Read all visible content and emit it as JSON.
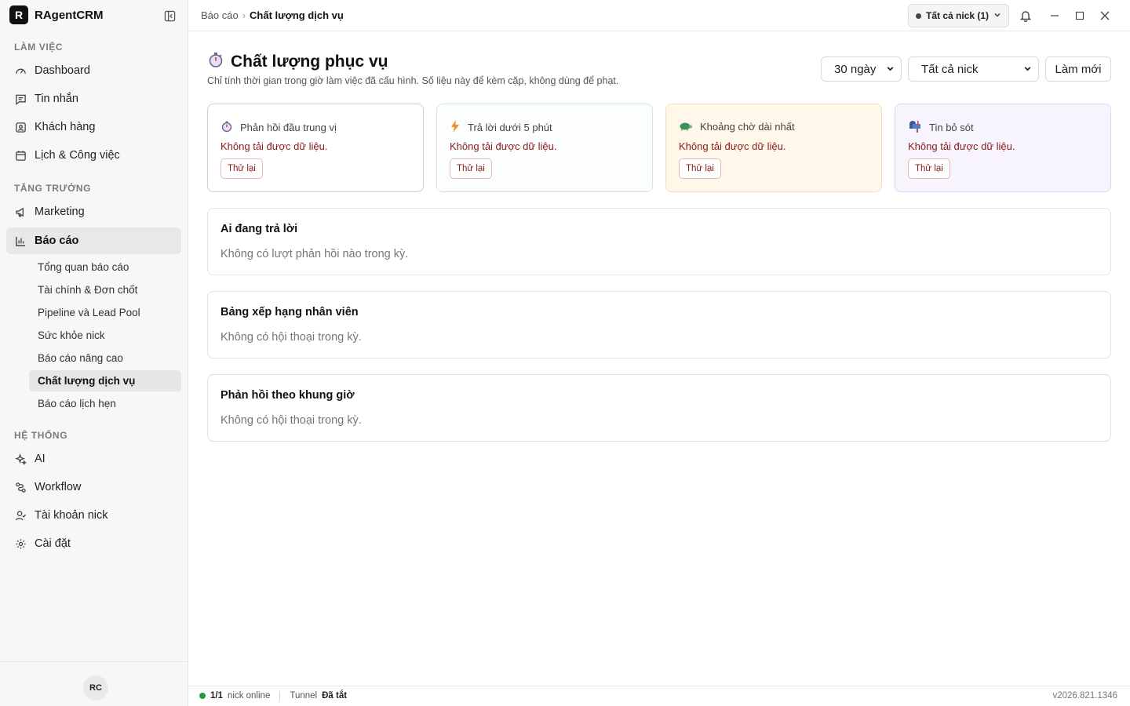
{
  "app": {
    "logo_letter": "R",
    "name": "RAgentCRM"
  },
  "sidebar": {
    "sections": [
      "LÀM VIỆC",
      "TĂNG TRƯỞNG",
      "HỆ THỐNG"
    ],
    "work_items": [
      {
        "label": "Dashboard",
        "icon": "gauge-icon"
      },
      {
        "label": "Tin nhắn",
        "icon": "message-icon"
      },
      {
        "label": "Khách hàng",
        "icon": "contact-icon"
      },
      {
        "label": "Lịch & Công việc",
        "icon": "calendar-icon"
      }
    ],
    "growth_items": [
      {
        "label": "Marketing",
        "icon": "megaphone-icon"
      },
      {
        "label": "Báo cáo",
        "icon": "bar-chart-icon"
      }
    ],
    "report_subitems": [
      "Tổng quan báo cáo",
      "Tài chính & Đơn chốt",
      "Pipeline và Lead Pool",
      "Sức khỏe nick",
      "Báo cáo nâng cao",
      "Chất lượng dịch vụ",
      "Báo cáo lịch hẹn"
    ],
    "system_items": [
      {
        "label": "AI",
        "icon": "sparkles-icon"
      },
      {
        "label": "Workflow",
        "icon": "workflow-icon"
      },
      {
        "label": "Tài khoản nick",
        "icon": "user-check-icon"
      },
      {
        "label": "Cài đặt",
        "icon": "gear-icon"
      }
    ],
    "avatar_initials": "RC"
  },
  "topbar": {
    "breadcrumb": [
      "Báo cáo",
      "Chất lượng dịch vụ"
    ],
    "nick_selector": "Tất cả nick (1)"
  },
  "page": {
    "title": "Chất lượng phục vụ",
    "subtitle": "Chỉ tính thời gian trong giờ làm việc đã cấu hình. Số liệu này để kèm cặp, không dùng để phạt.",
    "period_select": "30 ngày",
    "nick_select": "Tất cả nick",
    "refresh_label": "Làm mới"
  },
  "kpis": [
    {
      "title": "Phản hồi đầu trung vị",
      "icon": "stopwatch-icon",
      "error": "Không tải được dữ liệu.",
      "retry": "Thử lại"
    },
    {
      "title": "Trả lời dưới 5 phút",
      "icon": "lightning-icon",
      "error": "Không tải được dữ liệu.",
      "retry": "Thử lại"
    },
    {
      "title": "Khoảng chờ dài nhất",
      "icon": "turtle-icon",
      "error": "Không tải được dữ liệu.",
      "retry": "Thử lại"
    },
    {
      "title": "Tin bỏ sót",
      "icon": "mailbox-icon",
      "error": "Không tải được dữ liệu.",
      "retry": "Thử lại"
    }
  ],
  "panels": [
    {
      "title": "Ai đang trả lời",
      "empty": "Không có lượt phản hồi nào trong kỳ."
    },
    {
      "title": "Bảng xếp hạng nhân viên",
      "empty": "Không có hội thoại trong kỳ."
    },
    {
      "title": "Phản hồi theo khung giờ",
      "empty": "Không có hội thoại trong kỳ."
    }
  ],
  "statusbar": {
    "online_count": "1/1",
    "online_label": "nick online",
    "tunnel_label": "Tunnel",
    "tunnel_state": "Đã tắt",
    "version": "v2026.821.1346"
  },
  "colors": {
    "accent": "#111111",
    "error": "#8b1a1a",
    "online": "#1f9d3a"
  }
}
